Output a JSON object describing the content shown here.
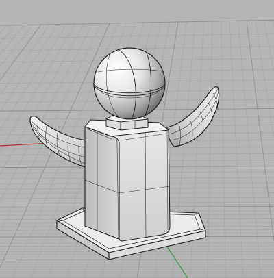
{
  "viewport": {
    "view": "perspective",
    "display_mode": "shaded",
    "background_color": "#b5b5b5",
    "grid": true,
    "grid_minor_color": "#a3a3a3",
    "grid_major_color": "#8f8f8f",
    "x_axis_color": "#b03030",
    "y_axis_color": "#2e9a3c"
  },
  "model": {
    "objects": [
      {
        "name": "base-plinth",
        "shape": "beveled-slab"
      },
      {
        "name": "body-box",
        "shape": "rounded-box"
      },
      {
        "name": "left-horn",
        "shape": "tapered-sweep"
      },
      {
        "name": "right-horn",
        "shape": "tapered-sweep"
      },
      {
        "name": "sphere-collar",
        "shape": "small-box"
      },
      {
        "name": "sphere",
        "shape": "sphere"
      }
    ],
    "surface_color": "#e4e4e4",
    "edge_color": "#1c1c1c",
    "isocurves": true
  }
}
